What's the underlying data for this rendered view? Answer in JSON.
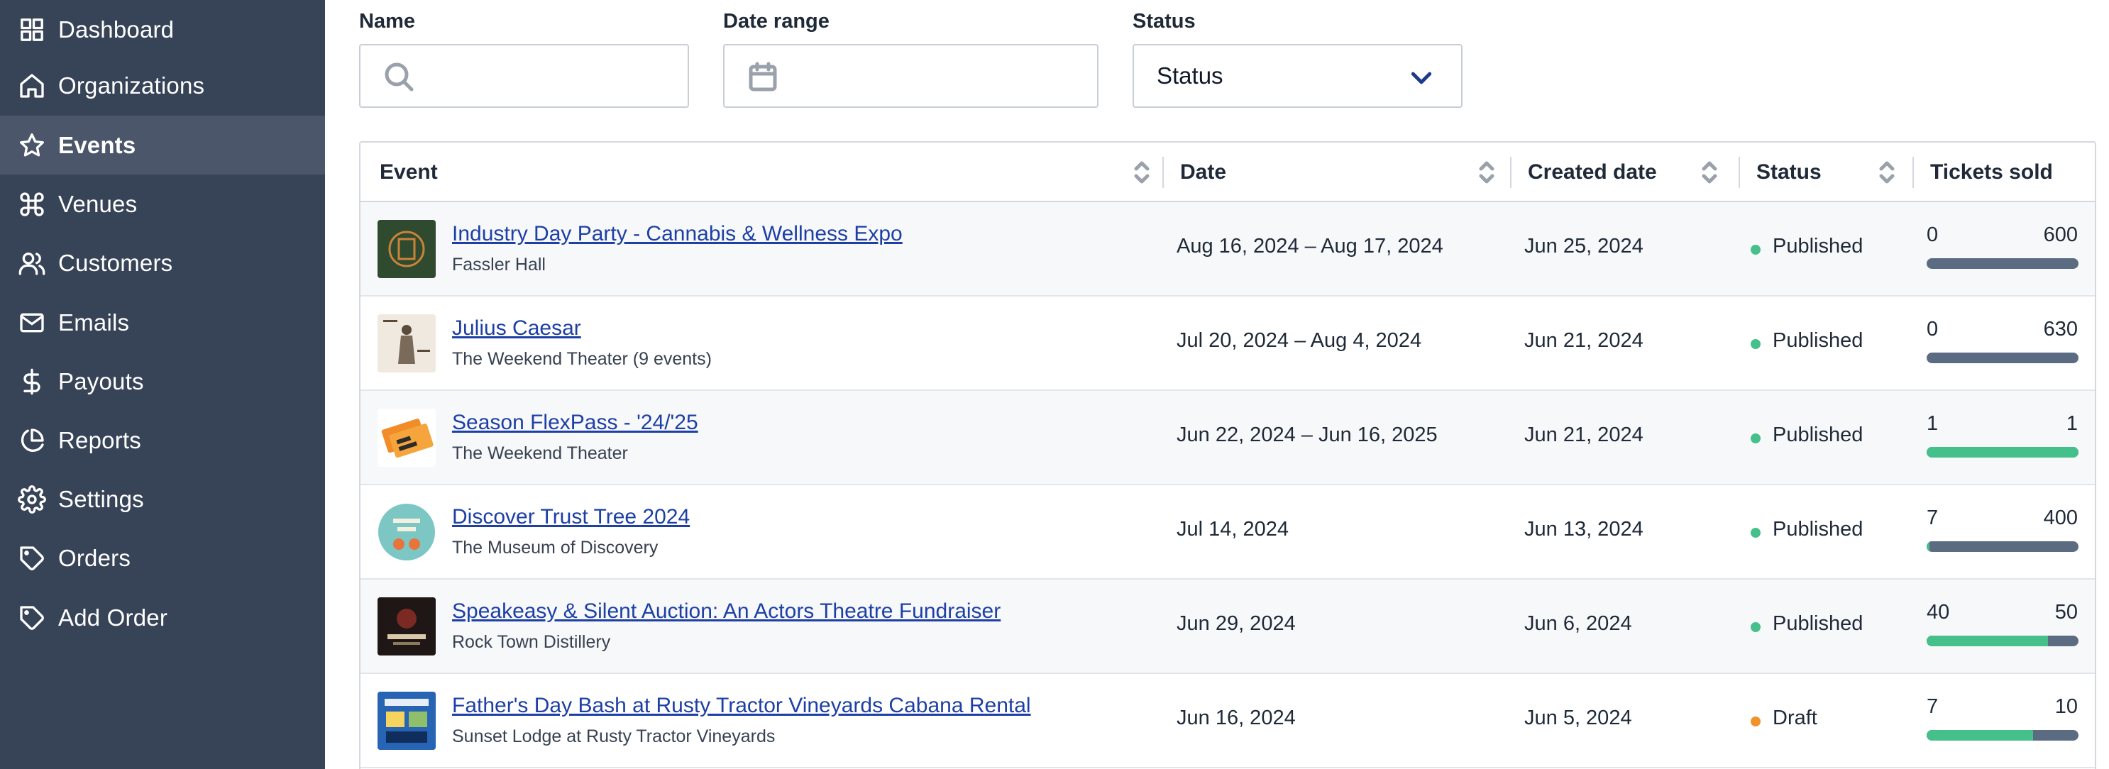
{
  "sidebar": {
    "items": [
      {
        "label": "Dashboard",
        "icon": "dashboard-icon",
        "active": false
      },
      {
        "label": "Organizations",
        "icon": "home-icon",
        "active": false
      },
      {
        "label": "Events",
        "icon": "star-icon",
        "active": true
      },
      {
        "label": "Venues",
        "icon": "command-icon",
        "active": false
      },
      {
        "label": "Customers",
        "icon": "users-icon",
        "active": false
      },
      {
        "label": "Emails",
        "icon": "mail-icon",
        "active": false
      },
      {
        "label": "Payouts",
        "icon": "dollar-icon",
        "active": false
      },
      {
        "label": "Reports",
        "icon": "pie-chart-icon",
        "active": false
      },
      {
        "label": "Settings",
        "icon": "gear-icon",
        "active": false
      },
      {
        "label": "Orders",
        "icon": "tag-icon",
        "active": false
      },
      {
        "label": "Add Order",
        "icon": "tag-icon",
        "active": false
      }
    ]
  },
  "filters": {
    "name_label": "Name",
    "name_value": "",
    "date_label": "Date range",
    "date_value": "",
    "status_label": "Status",
    "status_value": "Status"
  },
  "table": {
    "headers": {
      "event": "Event",
      "date": "Date",
      "created": "Created date",
      "status": "Status",
      "tickets": "Tickets sold"
    },
    "rows": [
      {
        "title": "Industry Day Party - Cannabis & Wellness Expo",
        "venue": "Fassler Hall",
        "date": "Aug 16, 2024 – Aug 17, 2024",
        "created": "Jun 25, 2024",
        "status": "Published",
        "sold": "0",
        "capacity": "600",
        "fill_fraction": 0.0
      },
      {
        "title": "Julius Caesar",
        "venue": "The Weekend Theater (9 events)",
        "date": "Jul 20, 2024 – Aug 4, 2024",
        "created": "Jun 21, 2024",
        "status": "Published",
        "sold": "0",
        "capacity": "630",
        "fill_fraction": 0.0
      },
      {
        "title": "Season FlexPass - '24/'25",
        "venue": "The Weekend Theater",
        "date": "Jun 22, 2024 – Jun 16, 2025",
        "created": "Jun 21, 2024",
        "status": "Published",
        "sold": "1",
        "capacity": "1",
        "fill_fraction": 1.0
      },
      {
        "title": "Discover Trust Tree 2024",
        "venue": "The Museum of Discovery",
        "date": "Jul 14, 2024",
        "created": "Jun 13, 2024",
        "status": "Published",
        "sold": "7",
        "capacity": "400",
        "fill_fraction": 0.0175
      },
      {
        "title": "Speakeasy & Silent Auction: An Actors Theatre Fundraiser",
        "venue": "Rock Town Distillery",
        "date": "Jun 29, 2024",
        "created": "Jun 6, 2024",
        "status": "Published",
        "sold": "40",
        "capacity": "50",
        "fill_fraction": 0.8
      },
      {
        "title": "Father's Day Bash at Rusty Tractor Vineyards Cabana Rental",
        "venue": "Sunset Lodge at Rusty Tractor Vineyards",
        "date": "Jun 16, 2024",
        "created": "Jun 5, 2024",
        "status": "Draft",
        "sold": "7",
        "capacity": "10",
        "fill_fraction": 0.7
      }
    ]
  },
  "colors": {
    "sidebar_bg": "#374357",
    "sidebar_active": "#4b566a",
    "link": "#1d3fa6",
    "published_dot": "#46c08a",
    "draft_dot": "#f0932b",
    "bar_track": "#5b6b82",
    "bar_fill": "#46c08a"
  }
}
